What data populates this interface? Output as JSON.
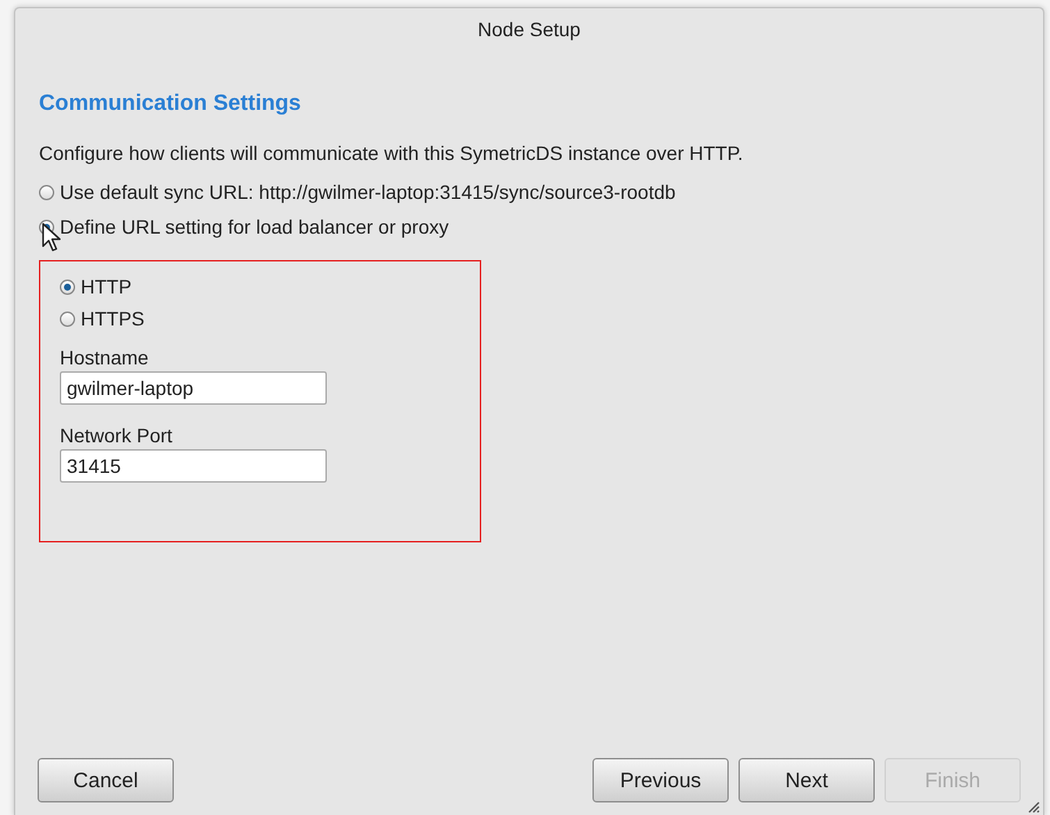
{
  "window": {
    "title": "Node Setup"
  },
  "heading": "Communication Settings",
  "description": "Configure how clients will communicate with this SymetricDS instance over HTTP.",
  "url_options": [
    {
      "label": "Use default sync URL: http://gwilmer-laptop:31415/sync/source3-rootdb",
      "selected": false
    },
    {
      "label": "Define URL setting for load balancer or proxy",
      "selected": true
    }
  ],
  "protocol_options": [
    {
      "label": "HTTP",
      "selected": true
    },
    {
      "label": "HTTPS",
      "selected": false
    }
  ],
  "fields": [
    {
      "label": "Hostname",
      "value": "gwilmer-laptop"
    },
    {
      "label": "Network Port",
      "value": "31415"
    }
  ],
  "buttons_left": [
    {
      "label": "Cancel",
      "disabled": false
    }
  ],
  "buttons_right": [
    {
      "label": "Previous",
      "disabled": false
    },
    {
      "label": "Next",
      "disabled": false
    },
    {
      "label": "Finish",
      "disabled": true
    }
  ]
}
